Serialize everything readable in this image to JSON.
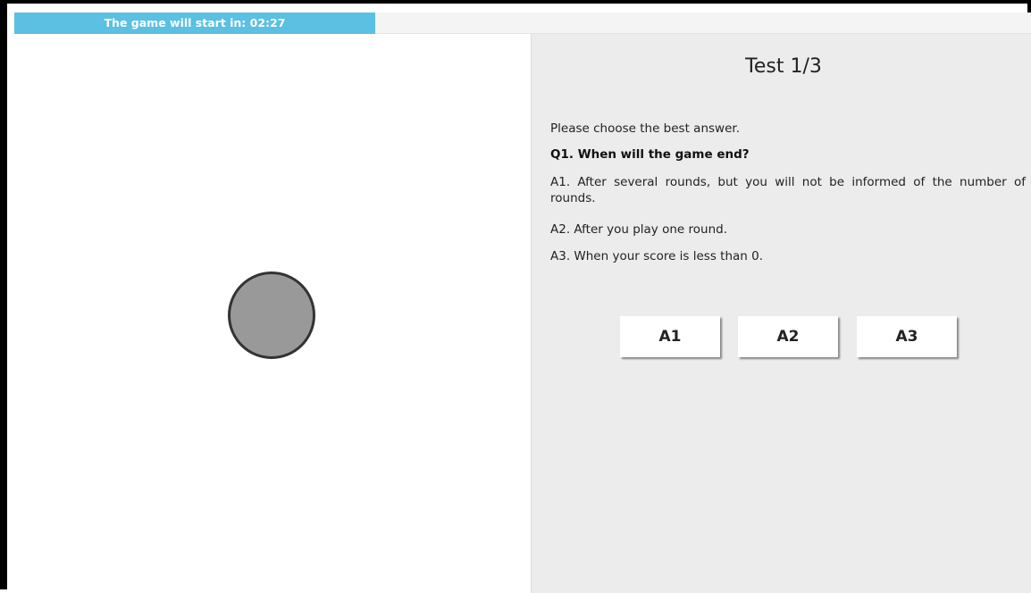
{
  "timer": {
    "label": "The game will start in: 02:27"
  },
  "test": {
    "title": "Test 1/3",
    "instruction": "Please choose the best answer.",
    "question": "Q1. When will the game end?",
    "answers": [
      {
        "text": "A1. After several rounds, but you will not be informed of the number of rounds."
      },
      {
        "text": "A2. After you play one round."
      },
      {
        "text": "A3. When your score is less than 0."
      }
    ],
    "buttons": [
      "A1",
      "A2",
      "A3"
    ]
  },
  "colors": {
    "timer_bar": "#5bc0e2",
    "panel_bg": "#ececec",
    "dot_fill": "#999999"
  },
  "icons": {
    "game_dot": "gray-circle"
  }
}
